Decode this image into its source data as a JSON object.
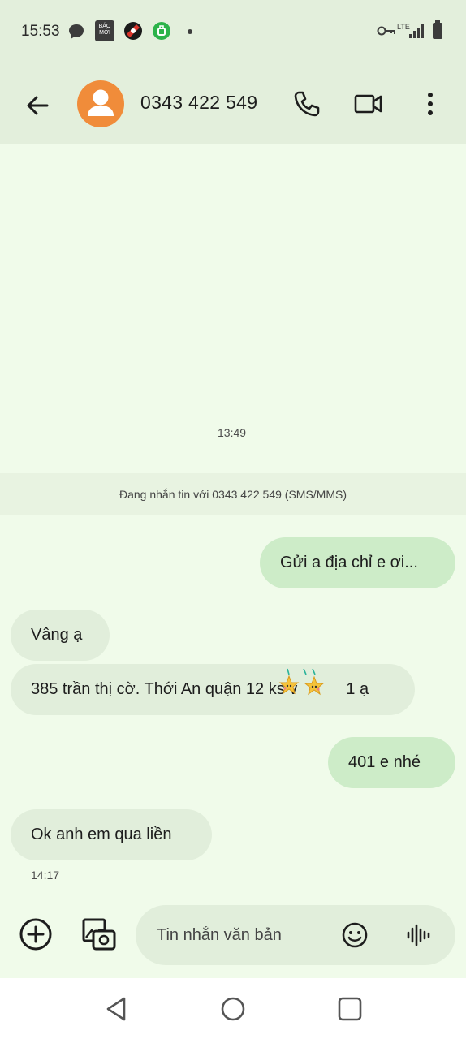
{
  "status_bar": {
    "time": "15:53",
    "notification_icons": [
      "chat-bubble-icon",
      "bao-moi-icon",
      "app-badge-icon",
      "green-app-icon",
      "dot-icon"
    ],
    "bao_moi_text": "BÁO MỚI",
    "right_icons": [
      "vpn-key-icon",
      "lte-signal-icon",
      "battery-icon"
    ],
    "lte_label": "LTE"
  },
  "app_bar": {
    "contact": "0343 422 549",
    "avatar_color": "#f08c3a",
    "icons": [
      "back-arrow-icon",
      "phone-icon",
      "video-call-icon",
      "more-vert-icon"
    ]
  },
  "conversation": {
    "timestamp_top": "13:49",
    "banner": "Đang nhắn tin với 0343 422 549 (SMS/MMS)",
    "messages": [
      {
        "direction": "outgoing",
        "text": "Gửi a địa chỉ e ơi..."
      },
      {
        "direction": "incoming",
        "text": "Vâng ạ"
      },
      {
        "direction": "incoming",
        "text": "385 trần thị cờ. Thới An quận 12 ks v",
        "text_after": "1 ạ",
        "emoji": "star-sticker-icon"
      },
      {
        "direction": "outgoing",
        "text": "401 e nhé"
      },
      {
        "direction": "incoming",
        "text": "Ok anh em qua liền"
      }
    ],
    "timestamp_bottom": "14:17"
  },
  "composer": {
    "placeholder": "Tin nhắn văn bản",
    "icons": [
      "add-circle-icon",
      "gallery-icon",
      "emoji-icon",
      "voice-icon"
    ]
  },
  "nav_bar": {
    "icons": [
      "back-triangle-icon",
      "home-circle-icon",
      "recents-square-icon"
    ]
  },
  "colors": {
    "background": "#f0fbea",
    "header": "#e3efdc",
    "outgoing_bubble": "#cdecc8",
    "incoming_bubble": "#e1eedb"
  }
}
